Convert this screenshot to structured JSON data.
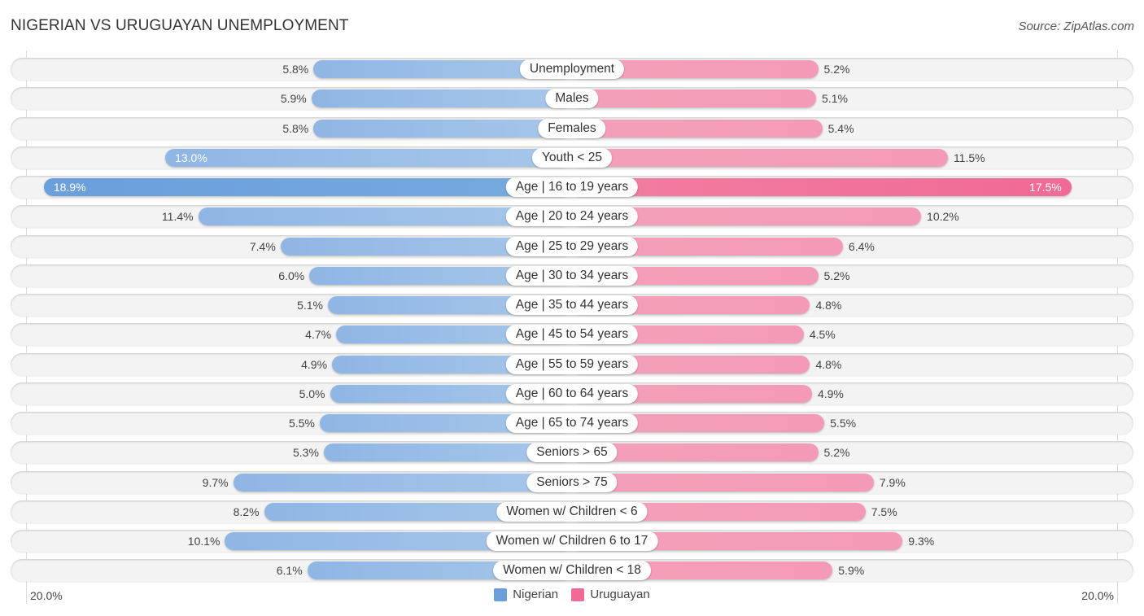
{
  "header": {
    "title": "NIGERIAN VS URUGUAYAN UNEMPLOYMENT",
    "source": "Source: ZipAtlas.com"
  },
  "colors": {
    "nigerian": "#6a9fdc",
    "uruguayan": "#f06a95"
  },
  "chart_data": {
    "type": "bar",
    "orientation": "horizontal-diverging",
    "title": "NIGERIAN VS URUGUAYAN UNEMPLOYMENT",
    "xlabel": "",
    "ylabel": "",
    "xlim": [
      0,
      20.0
    ],
    "axis_labels": {
      "left": "20.0%",
      "right": "20.0%"
    },
    "legend": {
      "position": "bottom-center",
      "entries": [
        "Nigerian",
        "Uruguayan"
      ]
    },
    "unit": "%",
    "categories": [
      "Unemployment",
      "Males",
      "Females",
      "Youth < 25",
      "Age | 16 to 19 years",
      "Age | 20 to 24 years",
      "Age | 25 to 29 years",
      "Age | 30 to 34 years",
      "Age | 35 to 44 years",
      "Age | 45 to 54 years",
      "Age | 55 to 59 years",
      "Age | 60 to 64 years",
      "Age | 65 to 74 years",
      "Seniors > 65",
      "Seniors > 75",
      "Women w/ Children < 6",
      "Women w/ Children 6 to 17",
      "Women w/ Children < 18"
    ],
    "series": [
      {
        "name": "Nigerian",
        "side": "left",
        "values": [
          5.8,
          5.9,
          5.8,
          13.0,
          18.9,
          11.4,
          7.4,
          6.0,
          5.1,
          4.7,
          4.9,
          5.0,
          5.5,
          5.3,
          9.7,
          8.2,
          10.1,
          6.1
        ],
        "labels": [
          "5.8%",
          "5.9%",
          "5.8%",
          "13.0%",
          "18.9%",
          "11.4%",
          "7.4%",
          "6.0%",
          "5.1%",
          "4.7%",
          "4.9%",
          "5.0%",
          "5.5%",
          "5.3%",
          "9.7%",
          "8.2%",
          "10.1%",
          "6.1%"
        ]
      },
      {
        "name": "Uruguayan",
        "side": "right",
        "values": [
          5.2,
          5.1,
          5.4,
          11.5,
          17.5,
          10.2,
          6.4,
          5.2,
          4.8,
          4.5,
          4.8,
          4.9,
          5.5,
          5.2,
          7.9,
          7.5,
          9.3,
          5.9
        ],
        "labels": [
          "5.2%",
          "5.1%",
          "5.4%",
          "11.5%",
          "17.5%",
          "10.2%",
          "6.4%",
          "5.2%",
          "4.8%",
          "4.5%",
          "4.8%",
          "4.9%",
          "5.5%",
          "5.2%",
          "7.9%",
          "7.5%",
          "9.3%",
          "5.9%"
        ]
      }
    ]
  }
}
